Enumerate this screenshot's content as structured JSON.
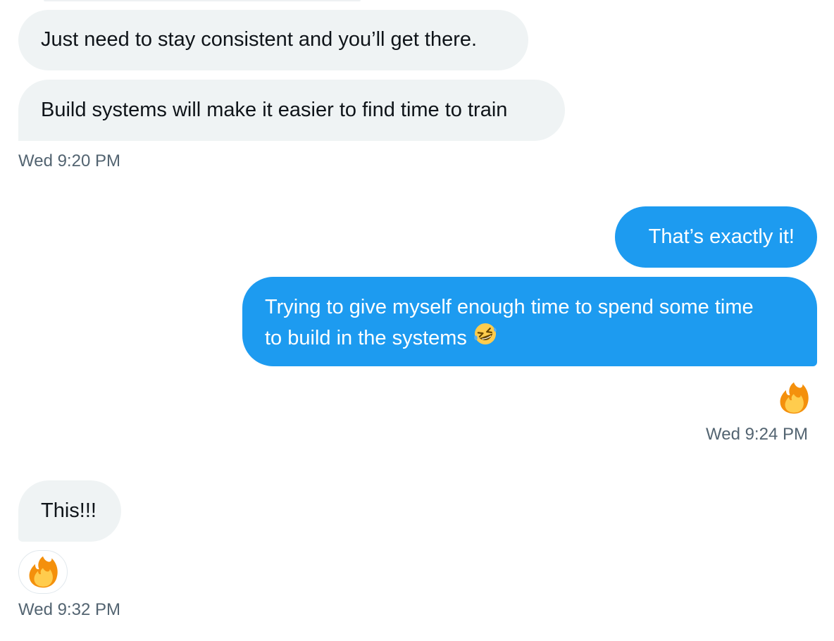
{
  "messages": [
    {
      "direction": "incoming",
      "text": "Just need to stay consistent and you’ll get there."
    },
    {
      "direction": "incoming",
      "text": "Build systems will make it easier to find time to train"
    },
    {
      "direction": "outgoing",
      "text": "That’s exactly it!"
    },
    {
      "direction": "outgoing",
      "text_line1": "Trying to give myself enough time to spend some time",
      "text_line2": "to build in the systems",
      "emoji": "rolling-on-floor-laughing-icon"
    },
    {
      "direction": "incoming",
      "text": "This!!!"
    }
  ],
  "timestamps": {
    "group1": "Wed 9:20 PM",
    "group2": "Wed 9:24 PM",
    "group3": "Wed 9:32 PM"
  },
  "reactions": {
    "group2": "fire-icon",
    "group3": "fire-icon"
  },
  "colors": {
    "incoming_bubble": "#eff3f4",
    "outgoing_bubble": "#1d9bf0",
    "incoming_text": "#0f1419",
    "outgoing_text": "#ffffff",
    "timestamp": "#536471"
  }
}
